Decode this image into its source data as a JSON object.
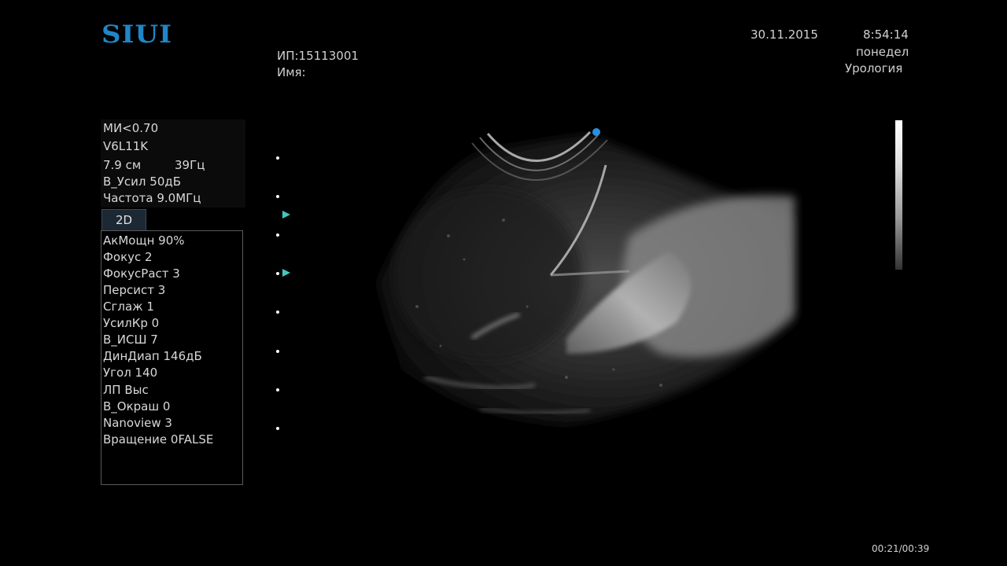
{
  "brand": {
    "logo_text": "SIUI",
    "logo_color": "#1f86c8"
  },
  "patient": {
    "id_line": "ИП:15113001",
    "name_line": "Имя:"
  },
  "header_right": {
    "date": "30.11.2015",
    "time": "8:54:14",
    "weekday": "понедел",
    "preset": "Урология"
  },
  "probe_info": {
    "mi": "МИ<0.70",
    "probe": "V6L11K",
    "depth": "7.9 см",
    "frame_rate": "39Гц",
    "gain": "В_Усил 50дБ",
    "frequency": "Частота 9.0МГц"
  },
  "mode_tab": {
    "label": "2D"
  },
  "mode_params": [
    "АкМощн 90%",
    "Фокус 2",
    "ФокусРаст 3",
    "Персист 3",
    "Сглаж 1",
    "УсилКр 0",
    "В_ИСШ 7",
    "ДинДиап 146дБ",
    "Угол 140",
    "ЛП Выс",
    "В_Окраш 0",
    "Nanoview 3",
    "Вращение 0FALSE"
  ],
  "playback": {
    "timer": "00:21/00:39"
  },
  "colors": {
    "background": "#000000",
    "focus_marker": "#40c8c0",
    "orientation_marker": "#2a8fe0"
  }
}
